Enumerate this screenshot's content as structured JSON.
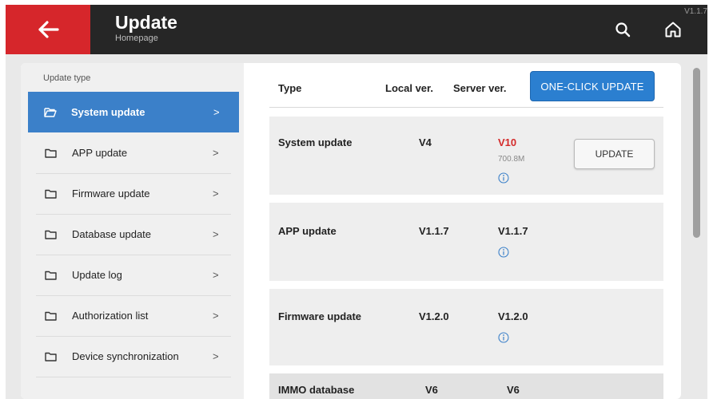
{
  "header": {
    "title": "Update",
    "subtitle": "Homepage",
    "version": "V1.1.7",
    "back_icon": "arrow-left-icon",
    "search_icon": "search-icon",
    "home_icon": "home-icon",
    "accent": "#d6262b",
    "background": "#262626"
  },
  "sidebar": {
    "heading": "Update type",
    "active_color": "#3b80c9",
    "items": [
      {
        "label": "System update",
        "icon": "folder-open-icon",
        "active": true
      },
      {
        "label": "APP update",
        "icon": "folder-icon"
      },
      {
        "label": "Firmware update",
        "icon": "folder-icon"
      },
      {
        "label": "Database update",
        "icon": "folder-icon"
      },
      {
        "label": "Update log",
        "icon": "folder-icon"
      },
      {
        "label": "Authorization list",
        "icon": "folder-icon"
      },
      {
        "label": "Device synchronization",
        "icon": "folder-icon"
      }
    ],
    "chevron": ">"
  },
  "table": {
    "headers": {
      "type": "Type",
      "local": "Local ver.",
      "server": "Server ver."
    },
    "one_click_label": "ONE-CLICK UPDATE",
    "rows": [
      {
        "type": "System update",
        "local": "V4",
        "server": "V10",
        "size": "700.8M",
        "update_label": "UPDATE",
        "server_color": "#d42a2a"
      },
      {
        "type": "APP update",
        "local": "V1.1.7",
        "server": "V1.1.7"
      },
      {
        "type": "Firmware update",
        "local": "V1.2.0",
        "server": "V1.2.0"
      },
      {
        "type": "IMMO database",
        "local": "V6",
        "server": "V6"
      }
    ]
  }
}
